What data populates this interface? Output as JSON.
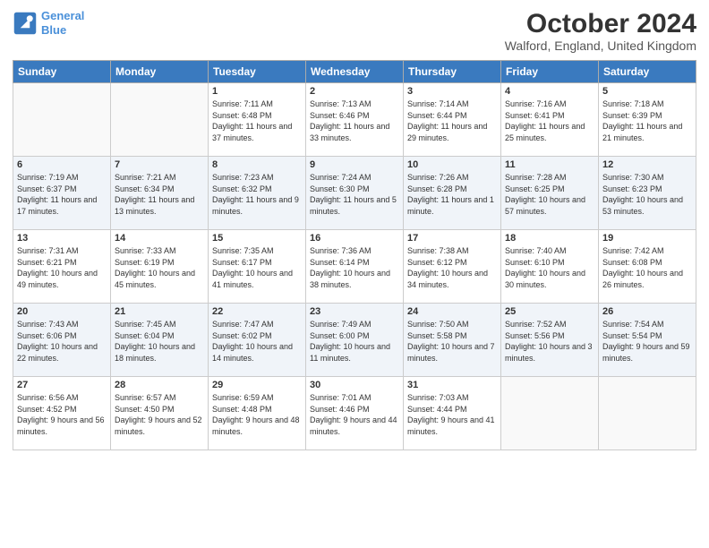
{
  "header": {
    "logo_line1": "General",
    "logo_line2": "Blue",
    "main_title": "October 2024",
    "subtitle": "Walford, England, United Kingdom"
  },
  "days_of_week": [
    "Sunday",
    "Monday",
    "Tuesday",
    "Wednesday",
    "Thursday",
    "Friday",
    "Saturday"
  ],
  "weeks": [
    [
      {
        "day": "",
        "sunrise": "",
        "sunset": "",
        "daylight": "",
        "empty": true
      },
      {
        "day": "",
        "sunrise": "",
        "sunset": "",
        "daylight": "",
        "empty": true
      },
      {
        "day": "1",
        "sunrise": "Sunrise: 7:11 AM",
        "sunset": "Sunset: 6:48 PM",
        "daylight": "Daylight: 11 hours and 37 minutes."
      },
      {
        "day": "2",
        "sunrise": "Sunrise: 7:13 AM",
        "sunset": "Sunset: 6:46 PM",
        "daylight": "Daylight: 11 hours and 33 minutes."
      },
      {
        "day": "3",
        "sunrise": "Sunrise: 7:14 AM",
        "sunset": "Sunset: 6:44 PM",
        "daylight": "Daylight: 11 hours and 29 minutes."
      },
      {
        "day": "4",
        "sunrise": "Sunrise: 7:16 AM",
        "sunset": "Sunset: 6:41 PM",
        "daylight": "Daylight: 11 hours and 25 minutes."
      },
      {
        "day": "5",
        "sunrise": "Sunrise: 7:18 AM",
        "sunset": "Sunset: 6:39 PM",
        "daylight": "Daylight: 11 hours and 21 minutes."
      }
    ],
    [
      {
        "day": "6",
        "sunrise": "Sunrise: 7:19 AM",
        "sunset": "Sunset: 6:37 PM",
        "daylight": "Daylight: 11 hours and 17 minutes."
      },
      {
        "day": "7",
        "sunrise": "Sunrise: 7:21 AM",
        "sunset": "Sunset: 6:34 PM",
        "daylight": "Daylight: 11 hours and 13 minutes."
      },
      {
        "day": "8",
        "sunrise": "Sunrise: 7:23 AM",
        "sunset": "Sunset: 6:32 PM",
        "daylight": "Daylight: 11 hours and 9 minutes."
      },
      {
        "day": "9",
        "sunrise": "Sunrise: 7:24 AM",
        "sunset": "Sunset: 6:30 PM",
        "daylight": "Daylight: 11 hours and 5 minutes."
      },
      {
        "day": "10",
        "sunrise": "Sunrise: 7:26 AM",
        "sunset": "Sunset: 6:28 PM",
        "daylight": "Daylight: 11 hours and 1 minute."
      },
      {
        "day": "11",
        "sunrise": "Sunrise: 7:28 AM",
        "sunset": "Sunset: 6:25 PM",
        "daylight": "Daylight: 10 hours and 57 minutes."
      },
      {
        "day": "12",
        "sunrise": "Sunrise: 7:30 AM",
        "sunset": "Sunset: 6:23 PM",
        "daylight": "Daylight: 10 hours and 53 minutes."
      }
    ],
    [
      {
        "day": "13",
        "sunrise": "Sunrise: 7:31 AM",
        "sunset": "Sunset: 6:21 PM",
        "daylight": "Daylight: 10 hours and 49 minutes."
      },
      {
        "day": "14",
        "sunrise": "Sunrise: 7:33 AM",
        "sunset": "Sunset: 6:19 PM",
        "daylight": "Daylight: 10 hours and 45 minutes."
      },
      {
        "day": "15",
        "sunrise": "Sunrise: 7:35 AM",
        "sunset": "Sunset: 6:17 PM",
        "daylight": "Daylight: 10 hours and 41 minutes."
      },
      {
        "day": "16",
        "sunrise": "Sunrise: 7:36 AM",
        "sunset": "Sunset: 6:14 PM",
        "daylight": "Daylight: 10 hours and 38 minutes."
      },
      {
        "day": "17",
        "sunrise": "Sunrise: 7:38 AM",
        "sunset": "Sunset: 6:12 PM",
        "daylight": "Daylight: 10 hours and 34 minutes."
      },
      {
        "day": "18",
        "sunrise": "Sunrise: 7:40 AM",
        "sunset": "Sunset: 6:10 PM",
        "daylight": "Daylight: 10 hours and 30 minutes."
      },
      {
        "day": "19",
        "sunrise": "Sunrise: 7:42 AM",
        "sunset": "Sunset: 6:08 PM",
        "daylight": "Daylight: 10 hours and 26 minutes."
      }
    ],
    [
      {
        "day": "20",
        "sunrise": "Sunrise: 7:43 AM",
        "sunset": "Sunset: 6:06 PM",
        "daylight": "Daylight: 10 hours and 22 minutes."
      },
      {
        "day": "21",
        "sunrise": "Sunrise: 7:45 AM",
        "sunset": "Sunset: 6:04 PM",
        "daylight": "Daylight: 10 hours and 18 minutes."
      },
      {
        "day": "22",
        "sunrise": "Sunrise: 7:47 AM",
        "sunset": "Sunset: 6:02 PM",
        "daylight": "Daylight: 10 hours and 14 minutes."
      },
      {
        "day": "23",
        "sunrise": "Sunrise: 7:49 AM",
        "sunset": "Sunset: 6:00 PM",
        "daylight": "Daylight: 10 hours and 11 minutes."
      },
      {
        "day": "24",
        "sunrise": "Sunrise: 7:50 AM",
        "sunset": "Sunset: 5:58 PM",
        "daylight": "Daylight: 10 hours and 7 minutes."
      },
      {
        "day": "25",
        "sunrise": "Sunrise: 7:52 AM",
        "sunset": "Sunset: 5:56 PM",
        "daylight": "Daylight: 10 hours and 3 minutes."
      },
      {
        "day": "26",
        "sunrise": "Sunrise: 7:54 AM",
        "sunset": "Sunset: 5:54 PM",
        "daylight": "Daylight: 9 hours and 59 minutes."
      }
    ],
    [
      {
        "day": "27",
        "sunrise": "Sunrise: 6:56 AM",
        "sunset": "Sunset: 4:52 PM",
        "daylight": "Daylight: 9 hours and 56 minutes."
      },
      {
        "day": "28",
        "sunrise": "Sunrise: 6:57 AM",
        "sunset": "Sunset: 4:50 PM",
        "daylight": "Daylight: 9 hours and 52 minutes."
      },
      {
        "day": "29",
        "sunrise": "Sunrise: 6:59 AM",
        "sunset": "Sunset: 4:48 PM",
        "daylight": "Daylight: 9 hours and 48 minutes."
      },
      {
        "day": "30",
        "sunrise": "Sunrise: 7:01 AM",
        "sunset": "Sunset: 4:46 PM",
        "daylight": "Daylight: 9 hours and 44 minutes."
      },
      {
        "day": "31",
        "sunrise": "Sunrise: 7:03 AM",
        "sunset": "Sunset: 4:44 PM",
        "daylight": "Daylight: 9 hours and 41 minutes."
      },
      {
        "day": "",
        "sunrise": "",
        "sunset": "",
        "daylight": "",
        "empty": true
      },
      {
        "day": "",
        "sunrise": "",
        "sunset": "",
        "daylight": "",
        "empty": true
      }
    ]
  ]
}
